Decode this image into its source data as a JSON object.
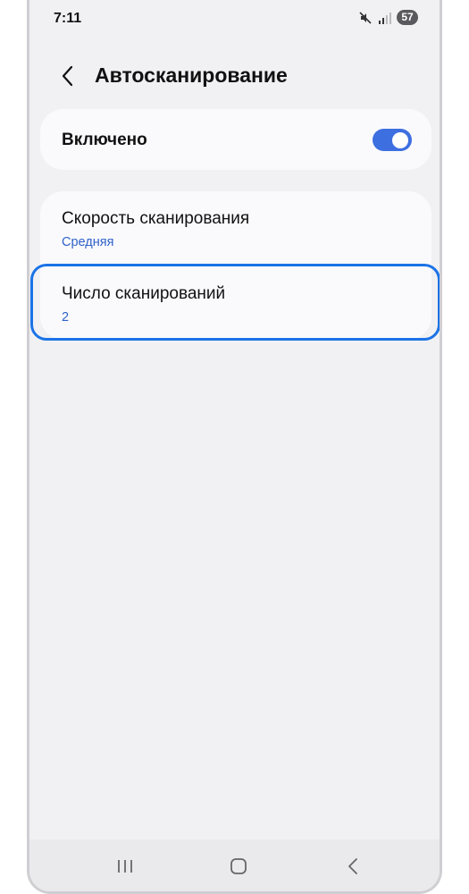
{
  "status_bar": {
    "time": "7:11",
    "battery": "57"
  },
  "header": {
    "title": "Автосканирование"
  },
  "enabled_card": {
    "label": "Включено",
    "toggle_on": true
  },
  "settings": [
    {
      "title": "Скорость сканирования",
      "value": "Средняя"
    },
    {
      "title": "Число сканирований",
      "value": "2"
    }
  ],
  "colors": {
    "accent": "#3e6fe0",
    "value_text": "#2f62c8",
    "highlight": "#1b73e6",
    "background": "#f1f1f4",
    "card": "#fafafd"
  },
  "icons": {
    "back": "chevron-left-icon",
    "mute": "mute-icon",
    "signal": "signal-icon",
    "battery": "battery-icon",
    "nav_recent": "recent-apps-icon",
    "nav_home": "home-icon",
    "nav_back": "back-icon"
  }
}
